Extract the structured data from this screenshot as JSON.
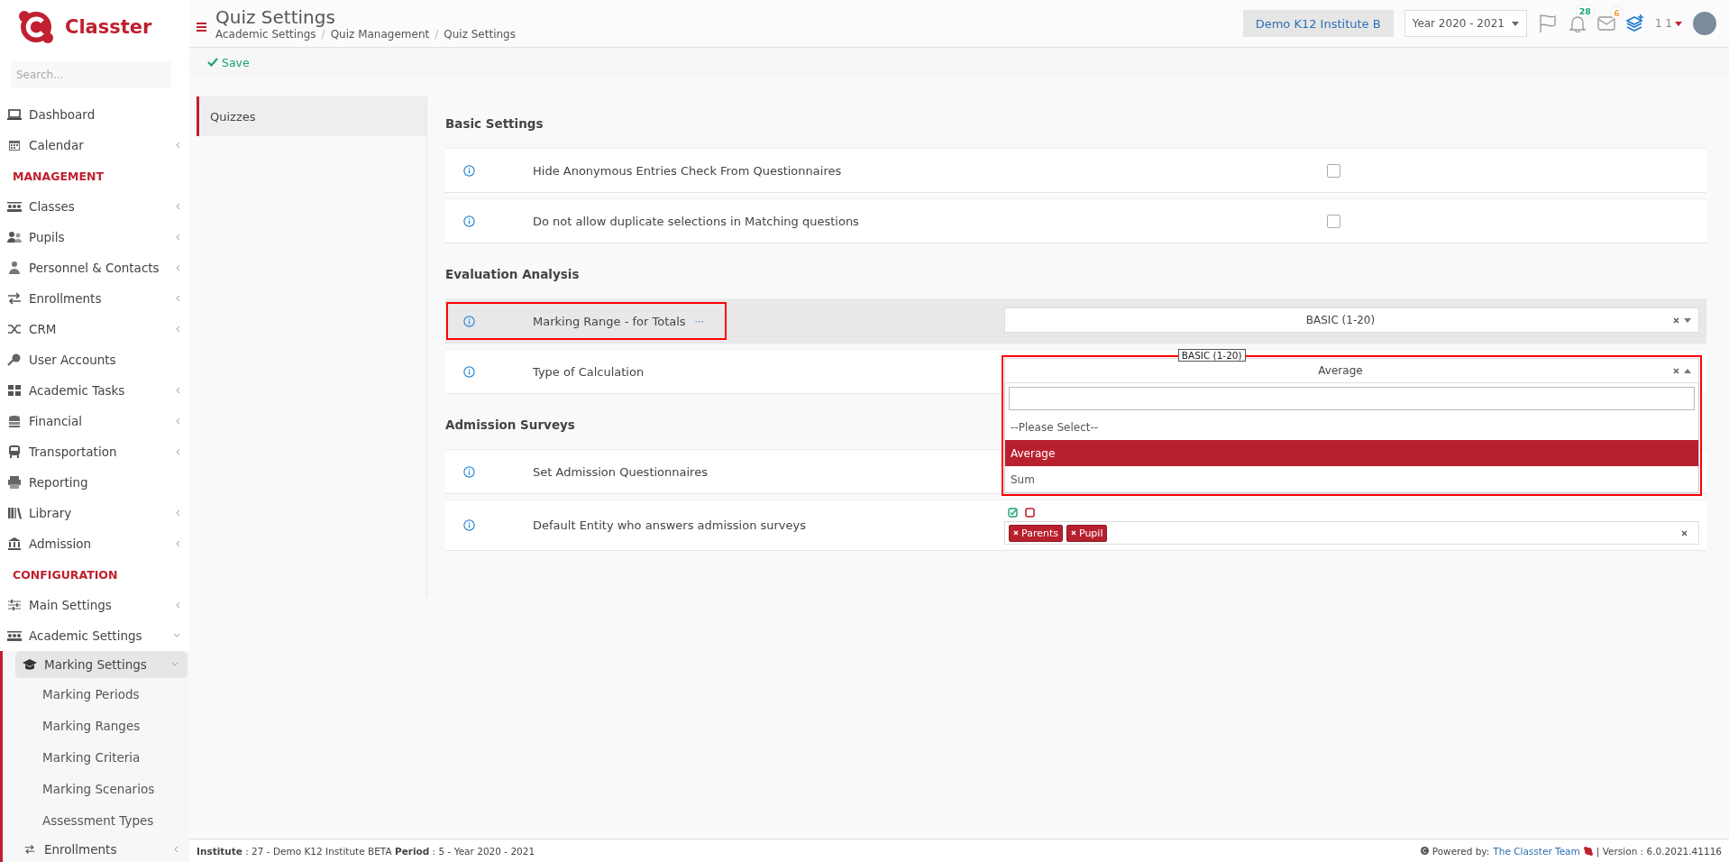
{
  "sidebar": {
    "brand": "Classter",
    "search_placeholder": "Search...",
    "items": [
      {
        "kind": "link",
        "label": "Dashboard",
        "expandable": false
      },
      {
        "kind": "link",
        "label": "Calendar",
        "expandable": true,
        "expanded": false
      },
      {
        "kind": "heading",
        "label": "MANAGEMENT"
      },
      {
        "kind": "link",
        "label": "Classes",
        "expandable": true,
        "expanded": false
      },
      {
        "kind": "link",
        "label": "Pupils",
        "expandable": true,
        "expanded": false
      },
      {
        "kind": "link",
        "label": "Personnel & Contacts",
        "expandable": true,
        "expanded": false
      },
      {
        "kind": "link",
        "label": "Enrollments",
        "expandable": true,
        "expanded": false
      },
      {
        "kind": "link",
        "label": "CRM",
        "expandable": true,
        "expanded": false
      },
      {
        "kind": "link",
        "label": "User Accounts",
        "expandable": false
      },
      {
        "kind": "link",
        "label": "Academic Tasks",
        "expandable": true,
        "expanded": false
      },
      {
        "kind": "link",
        "label": "Financial",
        "expandable": true,
        "expanded": false
      },
      {
        "kind": "link",
        "label": "Transportation",
        "expandable": true,
        "expanded": false
      },
      {
        "kind": "link",
        "label": "Reporting",
        "expandable": false
      },
      {
        "kind": "link",
        "label": "Library",
        "expandable": true,
        "expanded": false
      },
      {
        "kind": "link",
        "label": "Admission",
        "expandable": true,
        "expanded": false
      },
      {
        "kind": "heading",
        "label": "CONFIGURATION"
      },
      {
        "kind": "link",
        "label": "Main Settings",
        "expandable": true,
        "expanded": false
      },
      {
        "kind": "link",
        "label": "Academic Settings",
        "expandable": true,
        "expanded": true,
        "children": [
          {
            "kind": "link",
            "label": "Marking Settings",
            "expandable": true,
            "expanded": true,
            "children": [
              {
                "kind": "link",
                "label": "Marking Periods",
                "expandable": false
              },
              {
                "kind": "link",
                "label": "Marking Ranges",
                "expandable": false
              },
              {
                "kind": "link",
                "label": "Marking Criteria",
                "expandable": false
              },
              {
                "kind": "link",
                "label": "Marking Scenarios",
                "expandable": false
              },
              {
                "kind": "link",
                "label": "Assessment Types",
                "expandable": false
              }
            ]
          },
          {
            "kind": "link",
            "label": "Enrollments",
            "expandable": true,
            "expanded": false
          }
        ]
      }
    ]
  },
  "header": {
    "title": "Quiz Settings",
    "breadcrumbs": [
      {
        "label": "Academic Settings",
        "separator": "/"
      },
      {
        "label": "Quiz Management",
        "separator": "/"
      },
      {
        "label": "Quiz Settings"
      }
    ],
    "institute": "Demo K12 Institute B",
    "year": "Year 2020 - 2021",
    "notifications": "28",
    "messages": "6",
    "user": "1 1"
  },
  "toolbar": {
    "save": "Save"
  },
  "tabs": [
    {
      "label": "Quizzes",
      "selected": true
    }
  ],
  "sections": [
    {
      "title": "Basic Settings",
      "rows": [
        {
          "kind": "checkbox",
          "label": "Hide Anonymous Entries Check From Questionnaires",
          "checked": false
        },
        {
          "kind": "checkbox",
          "label": "Do not allow duplicate selections in Matching questions",
          "checked": false
        }
      ]
    },
    {
      "title": "Evaluation Analysis",
      "rows": [
        {
          "kind": "select",
          "label": "Marking Range - for Totals",
          "more": "···",
          "value": "BASIC (1-20)",
          "highlighted": true,
          "label_outlined": true
        },
        {
          "kind": "select",
          "label": "Type of Calculation",
          "value": "Average",
          "open": true,
          "control_outlined": true,
          "tooltip": "BASIC (1-20)",
          "options": [
            {
              "label": "--Please Select--",
              "selected": false
            },
            {
              "label": "Average",
              "selected": true
            },
            {
              "label": "Sum",
              "selected": false
            }
          ]
        }
      ]
    },
    {
      "title": "Admission Surveys",
      "rows": [
        {
          "kind": "blank",
          "label": "Set Admission Questionnaires"
        },
        {
          "kind": "tags",
          "label": "Default Entity who answers admission surveys",
          "tags": [
            "Parents",
            "Pupil"
          ]
        }
      ]
    }
  ],
  "footer": {
    "info": "**Institute** : 27 - Demo K12 Institute BETA **Period** : 5 - Year 2020 - 2021",
    "powered": "Powered by:",
    "team": "The Classter Team",
    "version": "| Version : 6.0.2021.41116"
  }
}
